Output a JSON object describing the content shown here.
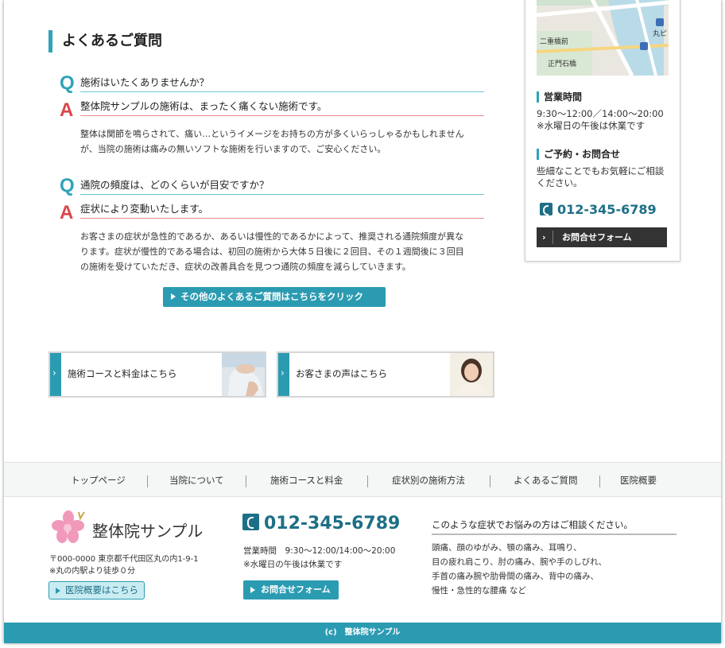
{
  "faq": {
    "title": "よくあるご質問",
    "items": [
      {
        "q_letter": "Q",
        "question": "施術はいたくありませんか？",
        "a_letter": "A",
        "answer": "整体院サンプルの施術は、まったく痛くない施術です。",
        "body": [
          "整体は関節を鳴らされて、痛い…というイメージをお持ちの方が多くいらっしゃるかもしれません",
          "が、当院の施術は痛みの無いソフトな施術を行いますので、ご安心ください。"
        ]
      },
      {
        "q_letter": "Q",
        "question": "通院の頻度は、どのくらいが目安ですか？",
        "a_letter": "A",
        "answer": "症状により変動いたします。",
        "body": [
          "お客さまの症状が急性的であるか、あるいは慢性的であるかによって、推奨される通院頻度が異な",
          "ります。症状が慢性的である場合は、初回の施術から大体５日後に２回目、その１週間後に３回目",
          "の施術を受けていただき、症状の改善具合を見つつ通院の頻度を減らしていきます。"
        ]
      }
    ],
    "more_label": "その他のよくあるご質問はこちらをクリック"
  },
  "banners": [
    {
      "label": "施術コースと料金はこちら",
      "arrow": "›"
    },
    {
      "label": "お客さまの声はこちら",
      "arrow": "›"
    }
  ],
  "sidebar": {
    "map_labels": [
      "二重橋前",
      "正門石橋",
      "丸ピ"
    ],
    "hours_heading": "営業時間",
    "hours_lines": [
      "9:30〜12:00／14:00〜20:00",
      "※水曜日の午後は休業です"
    ],
    "reserve_heading": "ご予約・お問合せ",
    "reserve_lines": [
      "些細なことでもお気軽にご相談",
      "ください。"
    ],
    "tel": "012-345-6789",
    "contact_label": "お問合せフォーム",
    "contact_arrow": "›"
  },
  "footer_nav": [
    "トップページ",
    "当院について",
    "施術コースと料金",
    "症状別の施術方法",
    "よくあるご質問",
    "医院概要"
  ],
  "footer": {
    "site_name": "整体院サンプル",
    "address_lines": [
      "〒000-0000 東京都千代田区丸の内1-9-1",
      "※丸の内駅より徒歩０分"
    ],
    "access_label": "医院概要はこちら",
    "tel": "012-345-6789",
    "hours_lines": [
      "営業時間　9:30〜12:00/14:00〜20:00",
      "※水曜日の午後は休業です"
    ],
    "contact_label": "お問合せフォーム",
    "symptom_heading": "このような症状でお悩みの方はご相談ください。",
    "symptom_lines": [
      "頭痛、顔のゆがみ、顎の痛み、耳鳴り、",
      "目の疲れ肩こり、肘の痛み、腕や手のしびれ、",
      "手首の痛み腕や肋骨間の痛み、背中の痛み、",
      "慢性・急性的な腰痛 など"
    ]
  },
  "copyright": "(c)　整体院サンプル",
  "colors": {
    "accent": "#2b9bb2",
    "q": "#2fa3b8",
    "a": "#d9464b",
    "tel": "#1d6f86"
  }
}
